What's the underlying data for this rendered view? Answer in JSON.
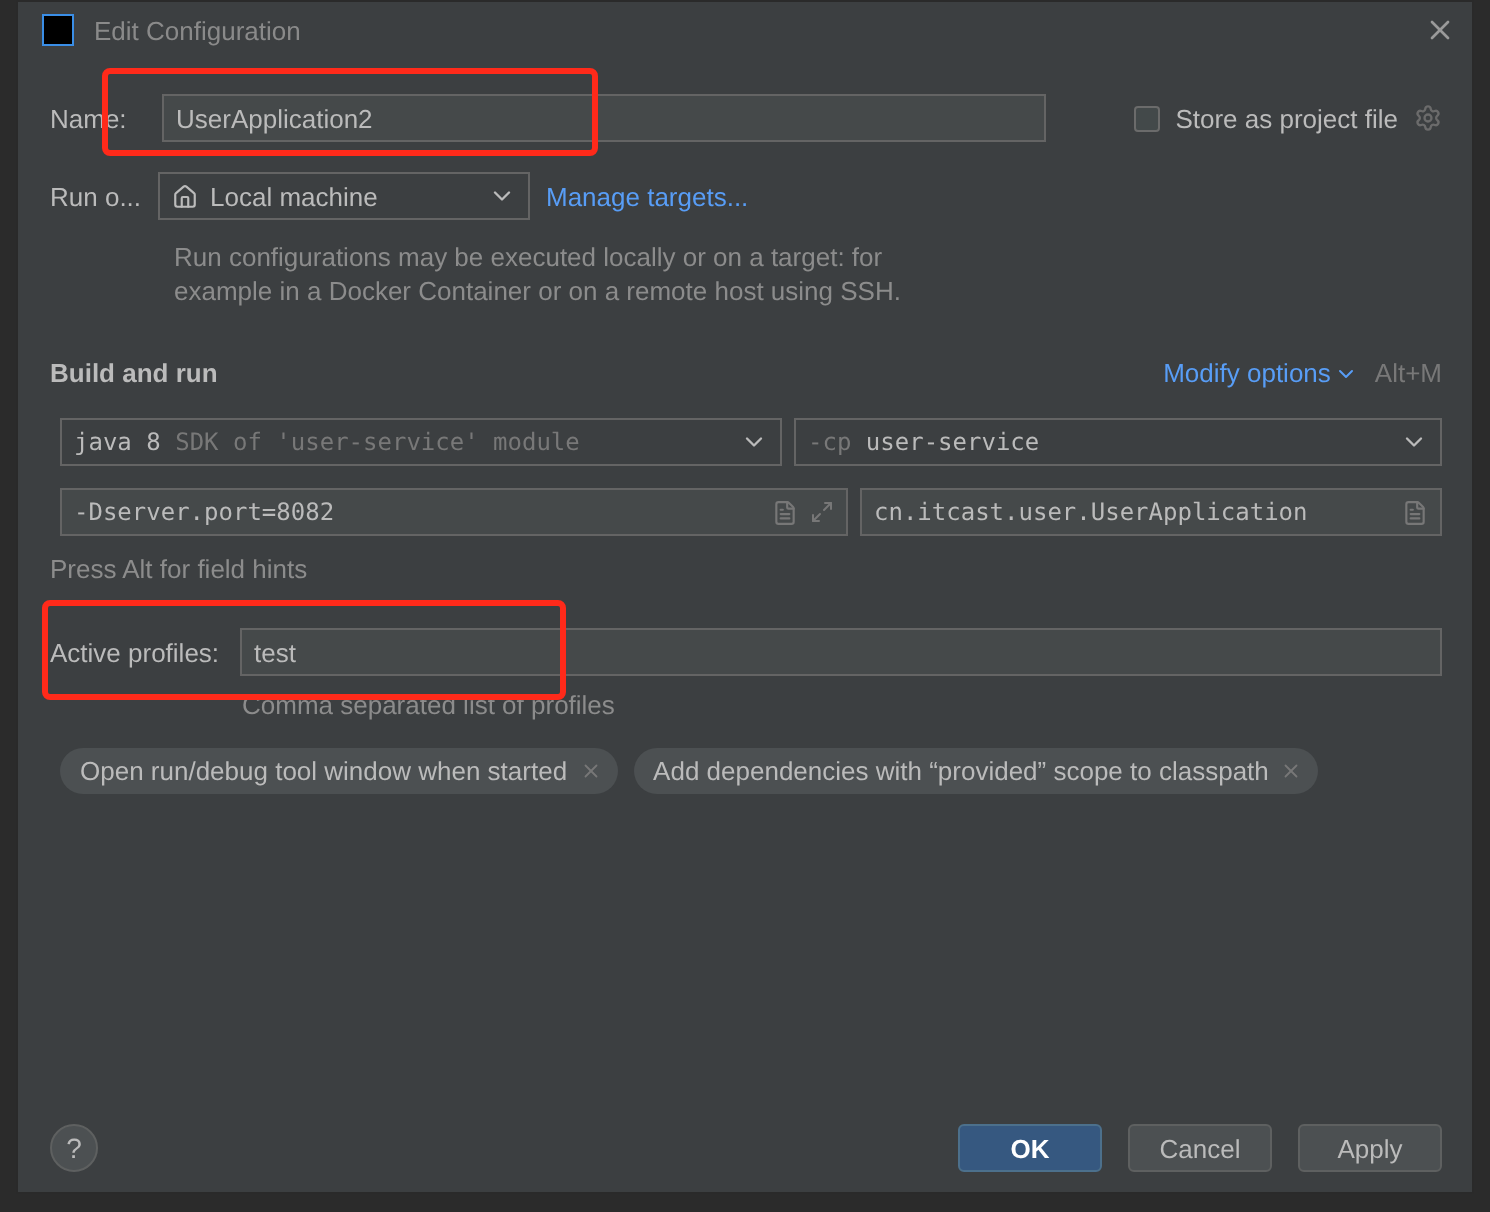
{
  "window": {
    "title": "Edit Configuration"
  },
  "name_row": {
    "label": "Name:",
    "value": "UserApplication2",
    "highlighted": true
  },
  "store_as_project": {
    "label": "Store as project file",
    "checked": false
  },
  "run_on": {
    "label": "Run o...",
    "target": "Local machine",
    "link": "Manage targets...",
    "hint": "Run configurations may be executed locally or on a target: for example in a Docker Container or on a remote host using SSH."
  },
  "build_and_run": {
    "title": "Build and run",
    "modify_options": "Modify options",
    "shortcut": "Alt+M",
    "jre": {
      "strong": "java 8",
      "weak": "SDK of 'user-service' module"
    },
    "classpath": {
      "weak": "-cp",
      "strong": "user-service"
    },
    "vm_options": "-Dserver.port=8082",
    "main_class": "cn.itcast.user.UserApplication",
    "field_hint": "Press Alt for field hints"
  },
  "active_profiles": {
    "label": "Active profiles:",
    "value": "test",
    "hint": "Comma separated list of profiles",
    "highlighted": true
  },
  "option_chips": [
    "Open run/debug tool window when started",
    "Add dependencies with “provided” scope to classpath"
  ],
  "buttons": [
    {
      "label": "OK",
      "kind": "primary"
    },
    {
      "label": "Cancel",
      "kind": "normal"
    },
    {
      "label": "Apply",
      "kind": "normal"
    }
  ],
  "help": "?"
}
